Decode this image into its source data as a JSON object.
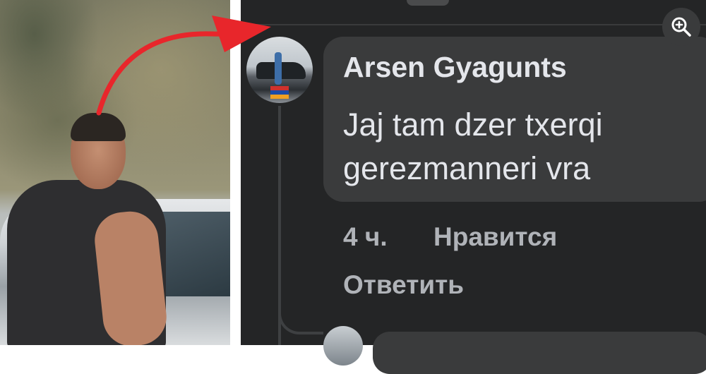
{
  "comment": {
    "author": "Arsen Gyagunts",
    "text": "Jaj tam dzer txerqi gerezmanneri vra",
    "time": "4 ч.",
    "like_label": "Нравится",
    "reply_label": "Ответить"
  },
  "icons": {
    "zoom": "zoom-in-icon"
  },
  "colors": {
    "arrow": "#e8262b",
    "bubble": "#3a3b3c",
    "background": "#242526",
    "text_primary": "#e4e6eb",
    "text_secondary": "#b0b3b8"
  }
}
